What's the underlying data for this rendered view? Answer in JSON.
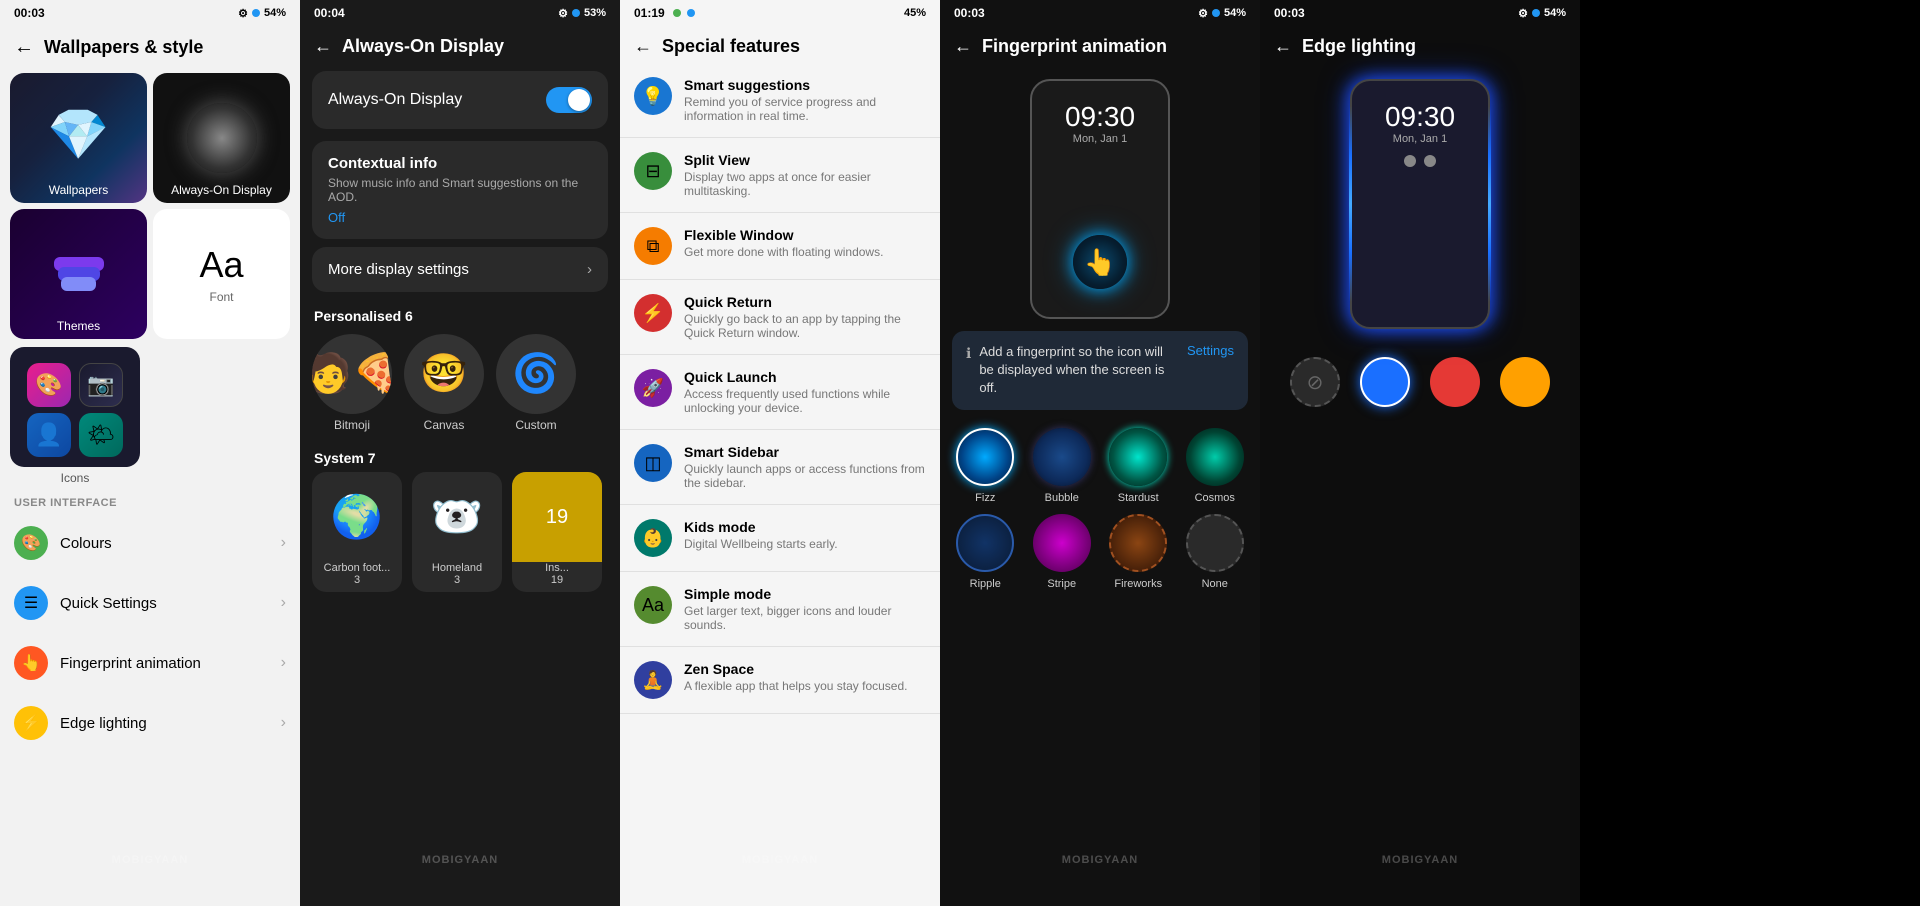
{
  "panel1": {
    "statusBar": {
      "time": "00:03",
      "battery": "54%",
      "icons": [
        "gear",
        "badge"
      ]
    },
    "header": {
      "back": "←",
      "title": "Wallpapers & style"
    },
    "thumbs": [
      {
        "id": "wallpapers",
        "type": "crystal",
        "label": "Wallpapers"
      },
      {
        "id": "aod",
        "type": "aod",
        "label": "Always-On Display"
      },
      {
        "id": "themes",
        "type": "themes",
        "label": "Themes"
      },
      {
        "id": "font",
        "type": "font",
        "label": "Font"
      },
      {
        "id": "icons",
        "type": "icons",
        "label": "Icons"
      }
    ],
    "sections": [
      {
        "label": "USER INTERFACE",
        "items": [
          {
            "id": "colours",
            "icon": "🎨",
            "iconClass": "ic-green",
            "label": "Colours"
          },
          {
            "id": "quickSettings",
            "icon": "☰",
            "iconClass": "ic-blue",
            "label": "Quick Settings"
          },
          {
            "id": "fpAnimation",
            "icon": "👆",
            "iconClass": "ic-orange",
            "label": "Fingerprint animation"
          },
          {
            "id": "edgeLighting",
            "icon": "⚡",
            "iconClass": "ic-yellow",
            "label": "Edge lighting"
          }
        ]
      }
    ]
  },
  "panel2": {
    "statusBar": {
      "time": "00:04",
      "battery": "53%"
    },
    "header": {
      "back": "←",
      "title": "Always-On Display"
    },
    "toggleLabel": "Always-On Display",
    "toggleOn": true,
    "contextual": {
      "title": "Contextual info",
      "sub": "Show music info and Smart suggestions on the AOD.",
      "status": "Off"
    },
    "moreSettings": "More display settings",
    "personalised": {
      "label": "Personalised",
      "count": "6"
    },
    "avatars": [
      {
        "label": "Bitmoji",
        "emoji": "🧑‍🍕"
      },
      {
        "label": "Canvas",
        "emoji": "👓"
      },
      {
        "label": "Custom",
        "emoji": "🌀"
      }
    ],
    "system": {
      "label": "System",
      "count": "7",
      "cards": [
        {
          "label": "Carbon foot...",
          "sub": "3",
          "emoji": "🌍"
        },
        {
          "label": "Homeland",
          "sub": "3",
          "emoji": "🐻‍❄️"
        },
        {
          "label": "Ins...",
          "sub": "19",
          "emoji": "🟡"
        }
      ]
    }
  },
  "panel3": {
    "statusBar": {
      "time": "01:19",
      "battery": "45%"
    },
    "header": {
      "back": "←",
      "title": "Special features"
    },
    "features": [
      {
        "id": "smart-suggestions",
        "iconClass": "fi-blue",
        "icon": "💡",
        "title": "Smart suggestions",
        "sub": "Remind you of service progress and information in real time."
      },
      {
        "id": "split-view",
        "iconClass": "fi-green",
        "icon": "⊟",
        "title": "Split View",
        "sub": "Display two apps at once for easier multitasking."
      },
      {
        "id": "flexible-window",
        "iconClass": "fi-amber",
        "icon": "⧉",
        "title": "Flexible Window",
        "sub": "Get more done with floating windows."
      },
      {
        "id": "quick-return",
        "iconClass": "fi-red",
        "icon": "⚡",
        "title": "Quick Return",
        "sub": "Quickly go back to an app by tapping the Quick Return window."
      },
      {
        "id": "quick-launch",
        "iconClass": "fi-purple",
        "icon": "🚀",
        "title": "Quick Launch",
        "sub": "Access frequently used functions while unlocking your device."
      },
      {
        "id": "smart-sidebar",
        "iconClass": "fi-dblue",
        "icon": "◫",
        "title": "Smart Sidebar",
        "sub": "Quickly launch apps or access functions from the sidebar."
      },
      {
        "id": "kids-mode",
        "iconClass": "fi-teal",
        "icon": "👶",
        "title": "Kids mode",
        "sub": "Digital Wellbeing starts early."
      },
      {
        "id": "simple-mode",
        "iconClass": "fi-lgreen",
        "icon": "Aa",
        "title": "Simple mode",
        "sub": "Get larger text, bigger icons and louder sounds."
      },
      {
        "id": "zen-space",
        "iconClass": "fi-indigo",
        "icon": "🧘",
        "title": "Zen Space",
        "sub": "A flexible app that helps you stay focused."
      }
    ]
  },
  "panel4": {
    "statusBar": {
      "time": "00:03",
      "battery": "54%"
    },
    "header": {
      "back": "←",
      "title": "Fingerprint animation"
    },
    "phonePreview": {
      "time": "09:30",
      "date": "Mon, Jan 1"
    },
    "tooltip": {
      "text": "Add a fingerprint so the icon will be displayed when the screen is off.",
      "link": "Settings"
    },
    "animations": [
      {
        "id": "fizz",
        "label": "Fizz",
        "class": "ac-fizz",
        "selected": true
      },
      {
        "id": "bubble",
        "label": "Bubble",
        "class": "ac-bubble",
        "selected": false
      },
      {
        "id": "stardust",
        "label": "Stardust",
        "class": "ac-stardust",
        "selected": false
      },
      {
        "id": "cosmos",
        "label": "Cosmos",
        "class": "ac-cosmos",
        "selected": false
      },
      {
        "id": "ripple",
        "label": "Ripple",
        "class": "ac-ripple",
        "selected": false
      },
      {
        "id": "stripe",
        "label": "Stripe",
        "class": "ac-stripe",
        "selected": false
      },
      {
        "id": "fireworks",
        "label": "Fireworks",
        "class": "ac-fireworks",
        "selected": false
      },
      {
        "id": "none",
        "label": "None",
        "class": "ac-none",
        "selected": false
      }
    ]
  },
  "panel5": {
    "statusBar": {
      "time": "00:03",
      "battery": "54%"
    },
    "header": {
      "back": "←",
      "title": "Edge lighting"
    },
    "phonePreview": {
      "time": "09:30",
      "date": "Mon, Jan 1"
    },
    "colors": [
      {
        "id": "none",
        "class": "cs-none",
        "symbol": "⊘"
      },
      {
        "id": "blue",
        "class": "cs-blue",
        "symbol": ""
      },
      {
        "id": "red",
        "class": "cs-red",
        "symbol": ""
      },
      {
        "id": "amber",
        "class": "cs-amber",
        "symbol": ""
      }
    ]
  },
  "watermark": "MOBIGYAAN"
}
